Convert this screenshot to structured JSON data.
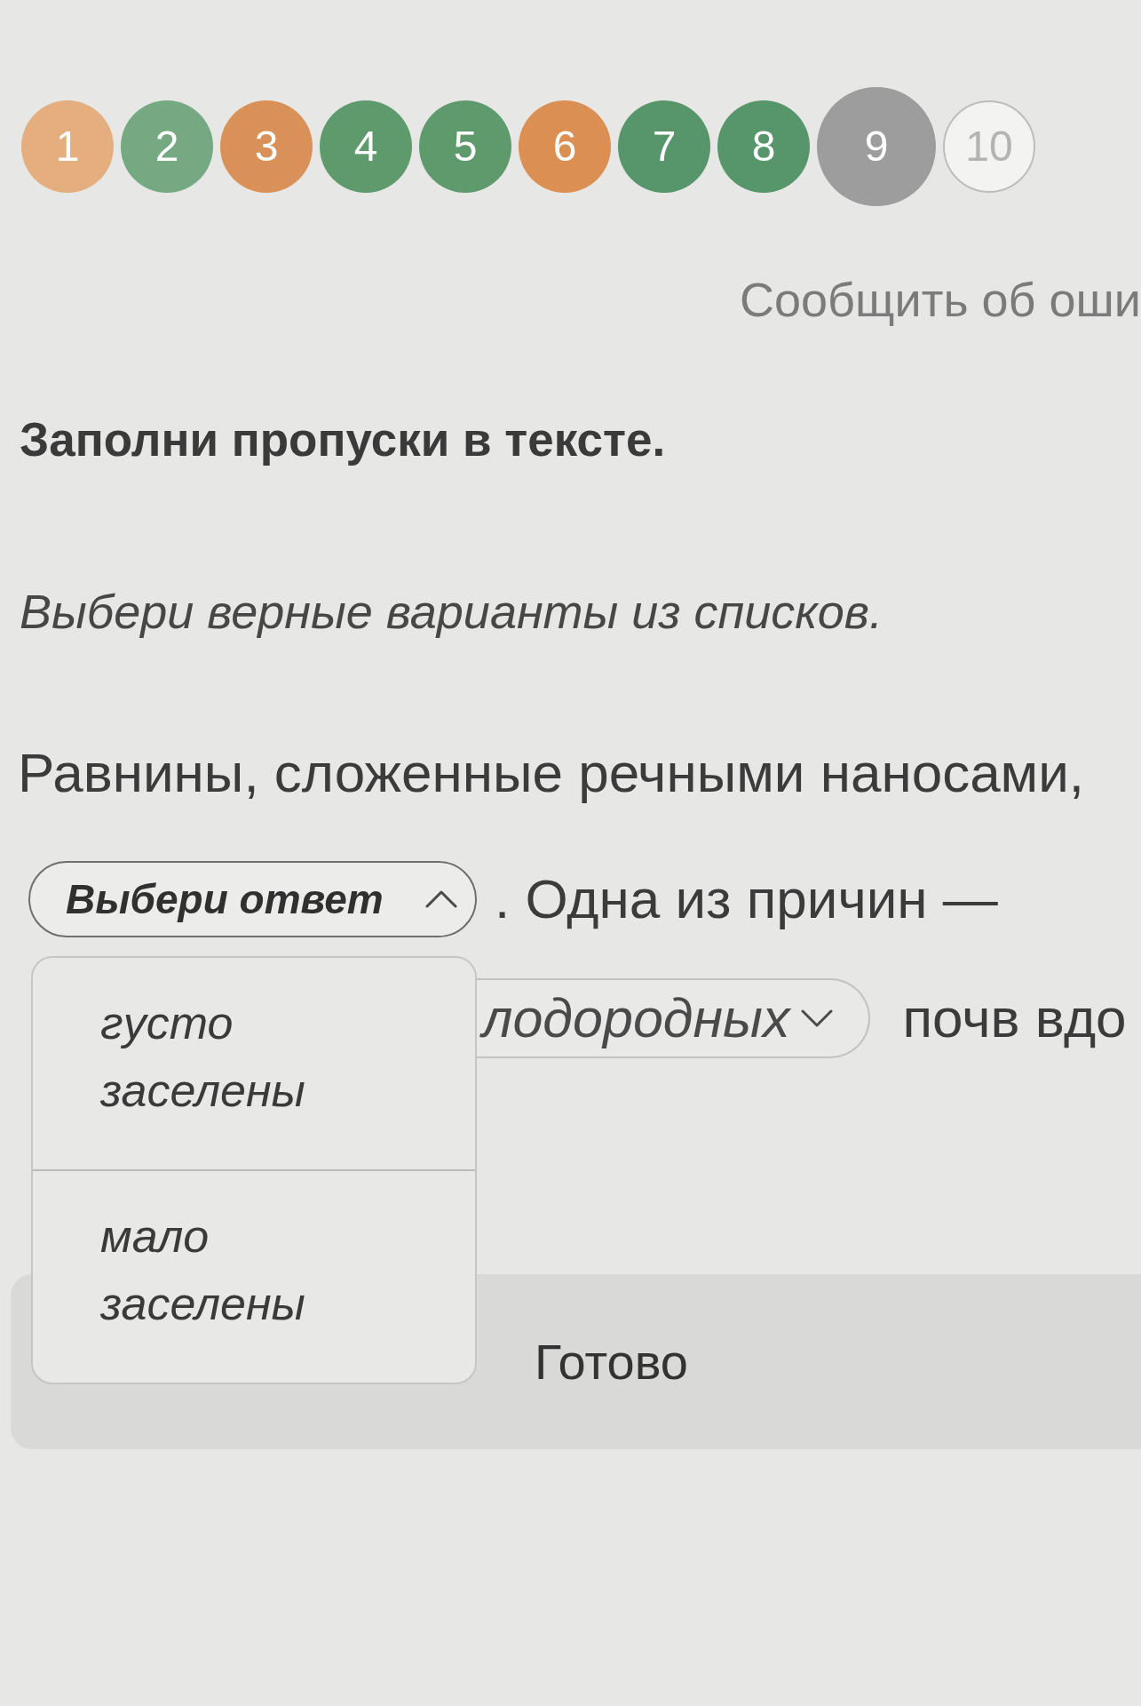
{
  "steps": [
    {
      "label": "1",
      "color": "#e4ae7e",
      "selected": false
    },
    {
      "label": "2",
      "color": "#74a982",
      "selected": false
    },
    {
      "label": "3",
      "color": "#d99158",
      "selected": false
    },
    {
      "label": "4",
      "color": "#5f9a6d",
      "selected": false
    },
    {
      "label": "5",
      "color": "#5f9a6d",
      "selected": false
    },
    {
      "label": "6",
      "color": "#dc8f52",
      "selected": false
    },
    {
      "label": "7",
      "color": "#57956a",
      "selected": false
    },
    {
      "label": "8",
      "color": "#57956a",
      "selected": false
    },
    {
      "label": "9",
      "color": "#9d9d9d",
      "selected": true
    },
    {
      "label": "10",
      "selected": false
    }
  ],
  "report_link": "Сообщить об оши",
  "task_title": "Заполни пропуски в тексте.",
  "instruction": "Выбери верные варианты из списков.",
  "passage": [
    [
      {
        "kind": "text",
        "text": "Равнины, сложенные речными наносами,"
      }
    ],
    [
      {
        "kind": "dropdown",
        "placeholder": "Выбери ответ",
        "expanded": true,
        "options": [
          {
            "label": "густо заселены",
            "selected": false
          },
          {
            "label": "мало заселены",
            "selected": false
          }
        ]
      },
      {
        "kind": "text",
        "text": ". Одна из причин —"
      }
    ],
    [
      {
        "kind": "dropdown",
        "value": "лодородных",
        "expanded": false,
        "covered": true
      },
      {
        "kind": "text",
        "text": "почв вдо"
      }
    ]
  ],
  "done_button": "Готово"
}
